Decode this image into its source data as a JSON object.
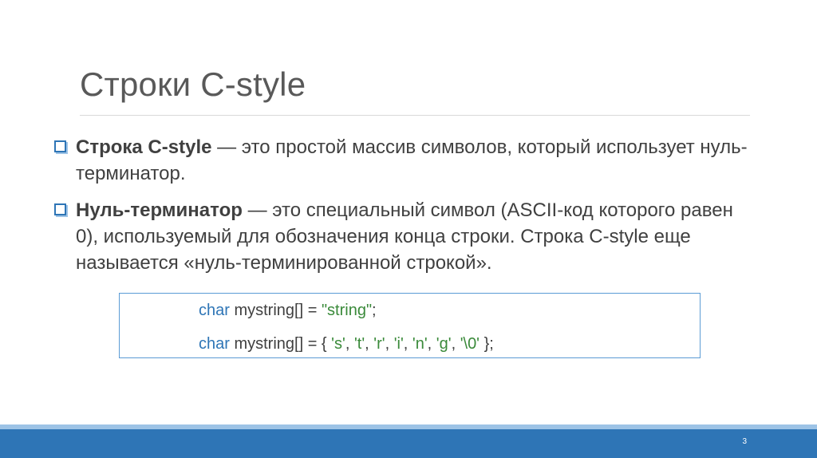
{
  "slide": {
    "title": "Строки C-style",
    "page_number": "3"
  },
  "bullets": [
    {
      "term": "Строка C-style",
      "text": " — это простой массив символов, который использует нуль-терминатор."
    },
    {
      "term": "Нуль-терминатор",
      "text": " — это специальный символ (ASCII-код которого равен 0), используемый для обозначения конца строки. Строка C-style еще называется «нуль-терминированной строкой»."
    }
  ],
  "code": {
    "line1": {
      "keyword": "char",
      "decl": " mystring[] = ",
      "string": "\"string\"",
      "end": ";"
    },
    "line2": {
      "keyword": "char",
      "decl": " mystring[] = { ",
      "chars": [
        "'s'",
        "'t'",
        "'r'",
        "'i'",
        "'n'",
        "'g'",
        "'\\0'"
      ],
      "sep": ", ",
      "end": " };"
    }
  },
  "colors": {
    "accent": "#2e75b6",
    "accent_light": "#9dc3e6",
    "code_string": "#3a8a3a",
    "text": "#404040"
  }
}
